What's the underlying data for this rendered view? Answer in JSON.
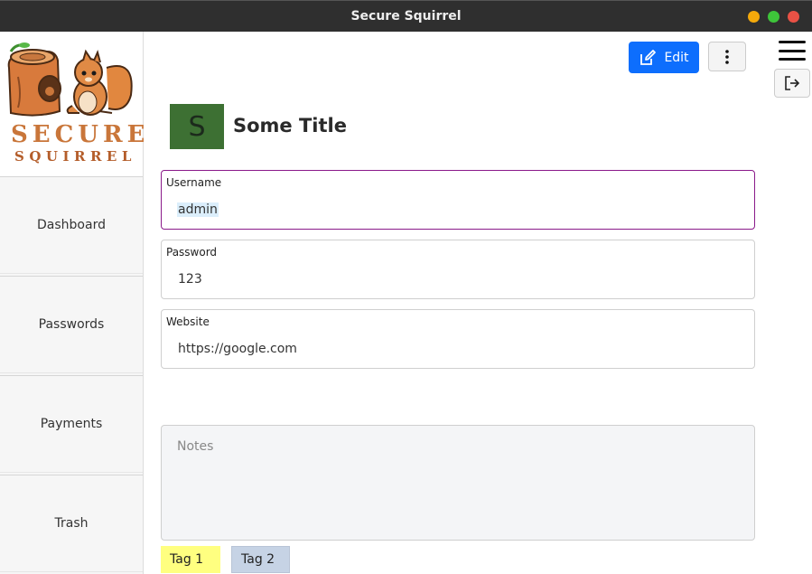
{
  "window": {
    "title": "Secure Squirrel"
  },
  "logo": {
    "line1": "SECURE",
    "line2": "SQUIRREL"
  },
  "sidebar": {
    "items": [
      {
        "label": "Dashboard"
      },
      {
        "label": "Passwords"
      },
      {
        "label": "Payments"
      },
      {
        "label": "Trash"
      }
    ]
  },
  "toolbar": {
    "edit_label": "Edit"
  },
  "entry": {
    "avatar_letter": "S",
    "avatar_color": "#3d7033",
    "title": "Some Title",
    "fields": [
      {
        "label": "Username",
        "value": "admin"
      },
      {
        "label": "Password",
        "value": "123"
      },
      {
        "label": "Website",
        "value": "https://google.com"
      }
    ],
    "notes_placeholder": "Notes",
    "tags": [
      {
        "label": "Tag 1",
        "color": "#ffff80"
      },
      {
        "label": "Tag 2",
        "color": "#c6d3e5"
      }
    ]
  },
  "colors": {
    "accent": "#0d6efd",
    "active_border": "#8a1a8a"
  }
}
